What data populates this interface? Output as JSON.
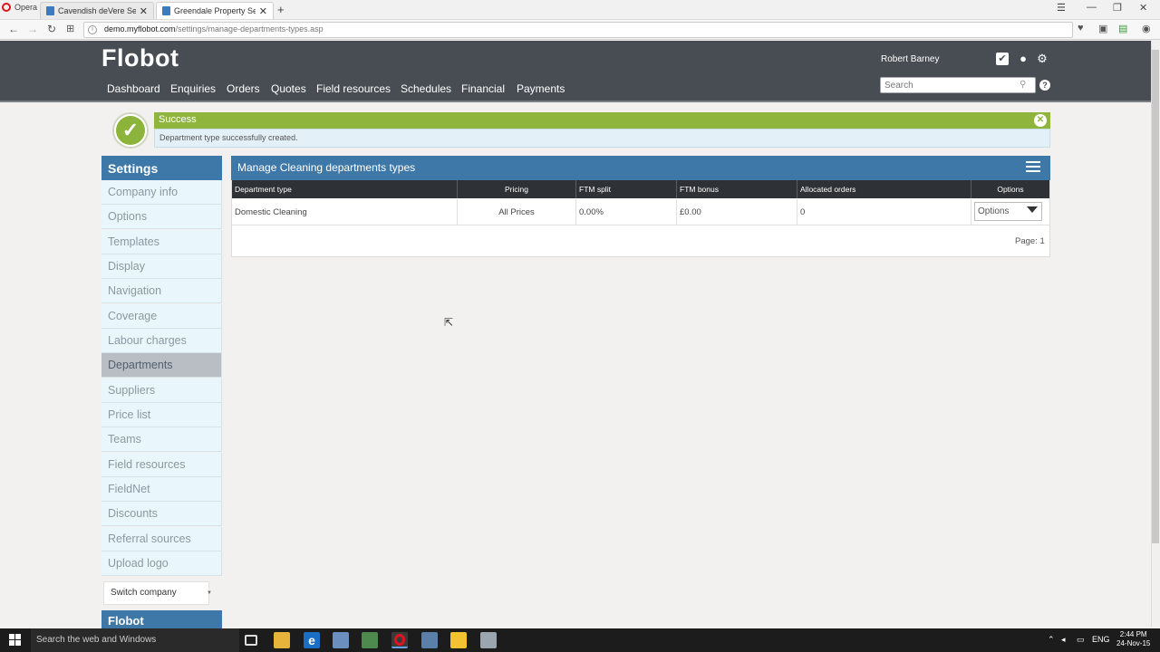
{
  "browser": {
    "app_name": "Opera",
    "tabs": [
      {
        "title": "Cavendish deVere Services"
      },
      {
        "title": "Greendale Property Services"
      }
    ],
    "url_domain": "demo.myflobot.com",
    "url_path": "/settings/manage-departments-types.asp"
  },
  "header": {
    "brand": "Flobot",
    "nav": [
      "Dashboard",
      "Enquiries",
      "Orders",
      "Quotes",
      "Field resources",
      "Schedules",
      "Financial",
      "Payments"
    ],
    "username": "Robert Barney",
    "search_placeholder": "Search",
    "help_glyph": "?"
  },
  "alert": {
    "title": "Success",
    "message": "Department type successfully created."
  },
  "sidebar": {
    "title": "Settings",
    "items": [
      "Company info",
      "Options",
      "Templates",
      "Display",
      "Navigation",
      "Coverage",
      "Labour charges",
      "Departments",
      "Suppliers",
      "Price list",
      "Teams",
      "Field resources",
      "FieldNet",
      "Discounts",
      "Referral sources",
      "Upload logo"
    ],
    "active": "Departments",
    "switch_company": "Switch company",
    "footer_brand": "Flobot"
  },
  "panel": {
    "title": "Manage Cleaning departments types",
    "columns": [
      "Department type",
      "Pricing",
      "FTM split",
      "FTM bonus",
      "Allocated orders",
      "Options"
    ],
    "rows": [
      {
        "type": "Domestic Cleaning",
        "pricing": "All Prices",
        "ftm_split": "0.00%",
        "ftm_bonus": "£0.00",
        "allocated": "0",
        "options": "Options"
      }
    ],
    "pager": "Page:  1"
  },
  "taskbar": {
    "search": "Search the web and Windows",
    "lang": "ENG",
    "time": "2:44 PM",
    "date": "24-Nov-15"
  }
}
